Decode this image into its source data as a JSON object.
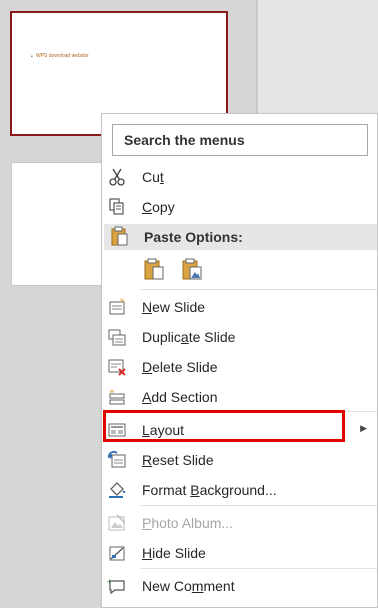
{
  "slides": {
    "slide1_link_text": "WPS download website"
  },
  "menu": {
    "search_placeholder": "Search the menus",
    "cut": {
      "pre": "Cu",
      "key": "t",
      "post": ""
    },
    "copy": {
      "pre": "",
      "key": "C",
      "post": "opy"
    },
    "paste_header": "Paste Options:",
    "new_slide": {
      "pre": "",
      "key": "N",
      "post": "ew Slide"
    },
    "duplicate_slide": {
      "pre": "Duplic",
      "key": "a",
      "post": "te Slide"
    },
    "delete_slide": {
      "pre": "",
      "key": "D",
      "post": "elete Slide"
    },
    "add_section": {
      "pre": "",
      "key": "A",
      "post": "dd Section"
    },
    "layout": {
      "pre": "",
      "key": "L",
      "post": "ayout"
    },
    "reset_slide": {
      "pre": "",
      "key": "R",
      "post": "eset Slide"
    },
    "format_background": {
      "pre": "Format ",
      "key": "B",
      "post": "ackground..."
    },
    "photo_album": {
      "pre": "",
      "key": "P",
      "post": "hoto Album..."
    },
    "hide_slide": {
      "pre": "",
      "key": "H",
      "post": "ide Slide"
    },
    "new_comment": {
      "pre": "New Co",
      "key": "m",
      "post": "ment"
    }
  },
  "colors": {
    "selected_slide_border": "#8b1a1a",
    "highlight_box": "#e00000"
  }
}
